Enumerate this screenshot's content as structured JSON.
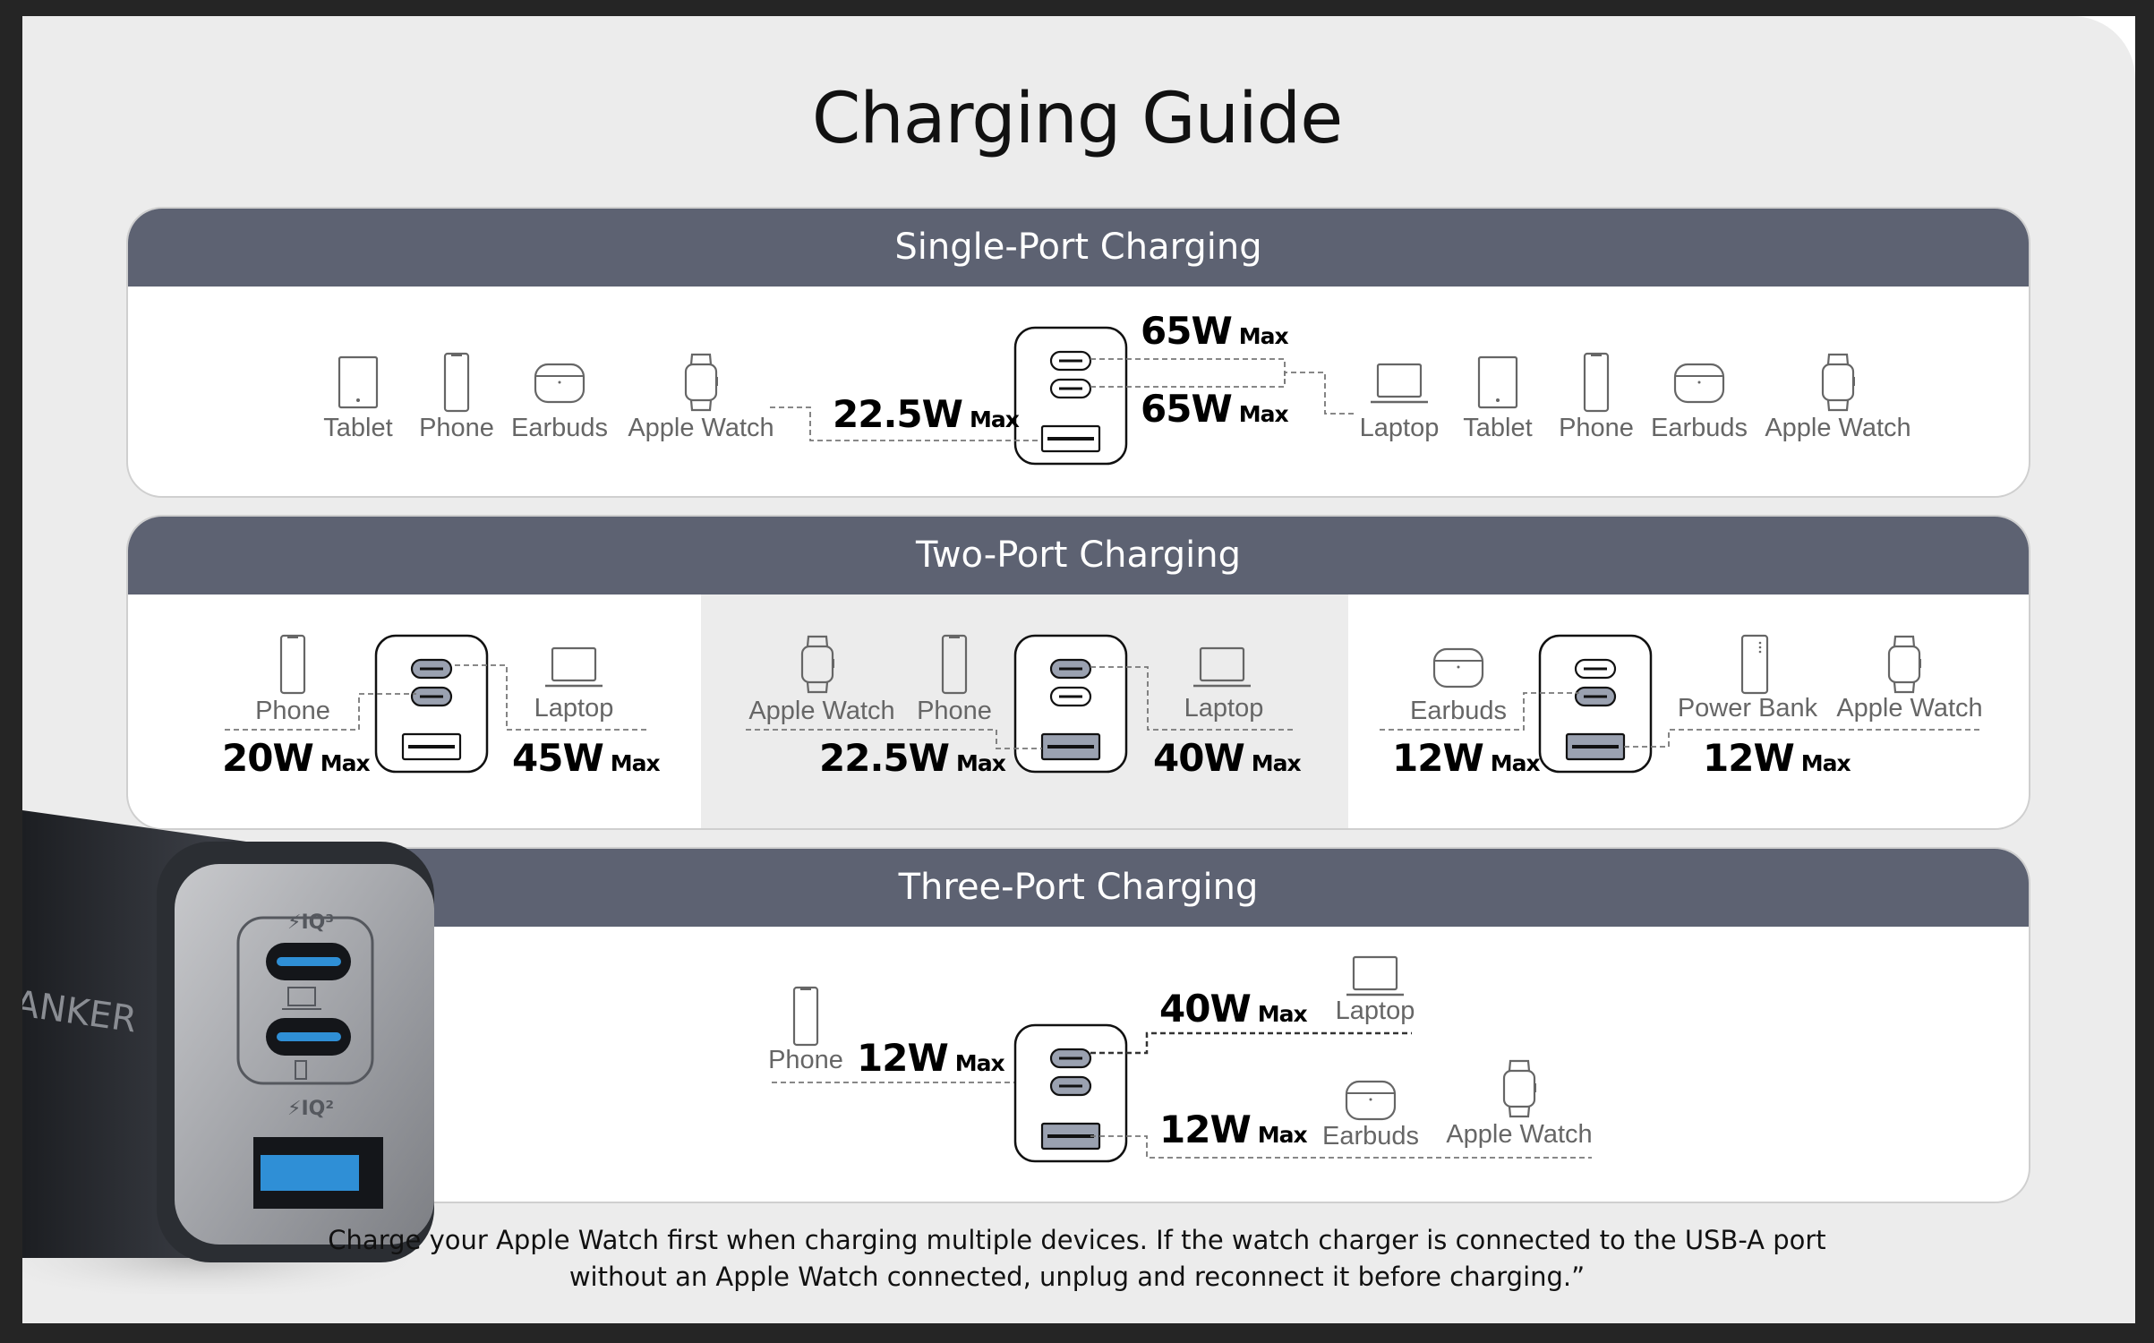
{
  "title": "Charging Guide",
  "colors": {
    "header": "#5d6272",
    "active_port": "#9aa1b0",
    "frame": "#252525",
    "background": "#ececec",
    "port_blue": "#2f8fd6"
  },
  "sections": {
    "single": {
      "title": "Single-Port Charging",
      "left": {
        "devices": [
          "Tablet",
          "Phone",
          "Earbuds",
          "Apple Watch"
        ],
        "watt": "22.5W",
        "unit": "Max",
        "port": "USB-A"
      },
      "right": {
        "devices": [
          "Laptop",
          "Tablet",
          "Phone",
          "Earbuds",
          "Apple Watch"
        ],
        "watt_top": "65W",
        "watt_bottom": "65W",
        "unit": "Max",
        "ports": [
          "USB-C1",
          "USB-C2"
        ]
      }
    },
    "two": {
      "title": "Two-Port Charging",
      "panels": [
        {
          "left_devices": [
            "Phone"
          ],
          "left_watt": "20W",
          "right_devices": [
            "Laptop"
          ],
          "right_watt": "45W",
          "unit": "Max",
          "active_ports": [
            "USB-C1",
            "USB-C2"
          ]
        },
        {
          "left_devices": [
            "Apple Watch",
            "Phone"
          ],
          "left_watt": "22.5W",
          "right_devices": [
            "Laptop"
          ],
          "right_watt": "40W",
          "unit": "Max",
          "active_ports": [
            "USB-C1",
            "USB-A"
          ]
        },
        {
          "left_devices": [
            "Earbuds"
          ],
          "left_watt": "12W",
          "right_devices": [
            "Power Bank",
            "Apple Watch"
          ],
          "right_watt": "12W",
          "unit": "Max",
          "active_ports": [
            "USB-C2",
            "USB-A"
          ]
        }
      ]
    },
    "three": {
      "title": "Three-Port Charging",
      "phone": {
        "device": "Phone",
        "watt": "12W",
        "unit": "Max"
      },
      "laptop": {
        "device": "Laptop",
        "watt": "40W",
        "unit": "Max"
      },
      "usb_a": {
        "devices": [
          "Earbuds",
          "Apple Watch"
        ],
        "watt": "12W",
        "unit": "Max"
      }
    }
  },
  "product": {
    "brand": "ANKER",
    "top_badge": "IQ3",
    "bottom_badge": "IQ2"
  },
  "note": {
    "line1": "Charge your Apple Watch first when charging multiple devices. If the watch charger is connected to the USB-A port",
    "line2": "without an Apple Watch connected, unplug and reconnect it before charging.”"
  }
}
